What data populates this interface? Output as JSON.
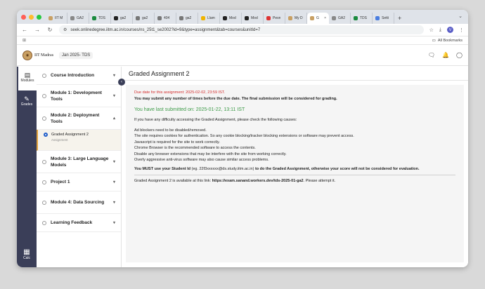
{
  "browser": {
    "tabs": [
      {
        "title": "IIT M",
        "fav_color": "#c9a063"
      },
      {
        "title": "GA2",
        "fav_color": "#888"
      },
      {
        "title": "TDS",
        "fav_color": "#1a8a3e"
      },
      {
        "title": "ga2",
        "fav_color": "#222"
      },
      {
        "title": "ga2",
        "fav_color": "#777"
      },
      {
        "title": "404",
        "fav_color": "#777"
      },
      {
        "title": "ga2",
        "fav_color": "#777"
      },
      {
        "title": "Llam",
        "fav_color": "#f0b400"
      },
      {
        "title": "Mod",
        "fav_color": "#222"
      },
      {
        "title": "Mod",
        "fav_color": "#222"
      },
      {
        "title": "Pesn",
        "fav_color": "#d33"
      },
      {
        "title": "My D",
        "fav_color": "#c9a063"
      },
      {
        "title": "G",
        "fav_color": "#c9a063",
        "active": true
      },
      {
        "title": "GA2",
        "fav_color": "#888"
      },
      {
        "title": "TDS",
        "fav_color": "#1a8a3e"
      },
      {
        "title": "Setti",
        "fav_color": "#4a7de0"
      }
    ],
    "url": "seek.onlinedegree.iitm.ac.in/courses/ns_25t1_se2002?id=9&type=assignment&tab=courses&unitId=7",
    "profile_initial": "V",
    "all_bookmarks": "All Bookmarks"
  },
  "header": {
    "logo_text": "IIT Madras",
    "term": "Jan 2025- TDS"
  },
  "rail": {
    "modules": "Modules",
    "grades": "Grades",
    "calc": "Calc"
  },
  "sidebar": {
    "modules": [
      {
        "label": "Course Introduction",
        "chevron": "▾"
      },
      {
        "label": "Module 1: Development Tools",
        "chevron": "▾"
      },
      {
        "label": "Module 2: Deployment Tools",
        "chevron": "▴"
      }
    ],
    "active_item": {
      "label": "Graded Assignment 2",
      "sub": "Assignment"
    },
    "modules_after": [
      {
        "label": "Module 3: Large Language Models",
        "chevron": "▾"
      },
      {
        "label": "Project 1",
        "chevron": "▾"
      },
      {
        "label": "Module 4: Data Sourcing",
        "chevron": "▾"
      },
      {
        "label": "Learning Feedback",
        "chevron": "▾"
      }
    ]
  },
  "content": {
    "title": "Graded Assignment 2",
    "due": "Due date for this assignment: 2025-02-02, 23:59 IST.",
    "warning": "You may submit any number of times before the due date. The final submission will be considered for grading.",
    "submitted": "You have last submitted on: 2025-01-22, 13:11 IST",
    "difficulty": "If you have any difficulty accessing the Graded Assignment, please check the following causes:",
    "causes": [
      "Ad blockers need to be disabled/removed.",
      "The site requires cookies for authentication. So any cookie blocking/tracker blocking extensions or software may prevent access.",
      "Javascript is required for the site to work correctly.",
      "Chrome Browser is the recommended software to access the contents.",
      "Disable any browser extensions that may be interfere with the site from working correctly.",
      "Overly aggressive anti-virus software may also cause similar access problems."
    ],
    "must_a": "You MUST use your Student Id",
    "must_b": " (eg. 22f3xxxxxx@ds.study.iitm.ac.in) ",
    "must_c": "to do the Graded Assignment, otherwise your score will not be considered for evaluation.",
    "link_a": "Graded Assignment 2 is available at this link: ",
    "link_url": "https://exam.sanand.workers.dev/tds-2025-01-ga2",
    "link_c": ". Please attempt it."
  }
}
